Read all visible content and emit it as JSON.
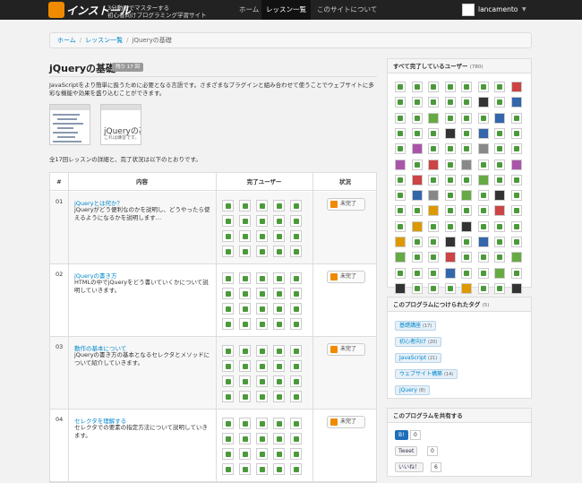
{
  "nav": {
    "logo_text": "インストール",
    "tagline1": "3分動画でマスターする",
    "tagline2": "初心者向けプログラミング学習サイト",
    "links": [
      "ホーム",
      "レッスン一覧",
      "このサイトについて"
    ],
    "user": "lancamento"
  },
  "breadcrumb": {
    "home": "ホーム",
    "lessons": "レッスン一覧",
    "current": "jQueryの基礎"
  },
  "course": {
    "title": "jQueryの基礎",
    "badge": "残り 17 回",
    "description": "JavaScriptをより簡単に扱うために必要となる言語です。さまざまなプラグインと組み合わせて使うことでウェブサイトに多彩な機能や効果を盛り込むことができます。",
    "preview_text": "jQueryの基本",
    "preview_sub": "これは練習です。",
    "summary": "全17回レッスンの詳細と、完了状況は以下のとおりです。"
  },
  "table": {
    "headers": [
      "#",
      "内容",
      "完了ユーザー",
      "状況"
    ],
    "rows": [
      {
        "num": "01",
        "title": "jQueryとは何か？",
        "desc": "jQueryがどう便利なのかを説明し、どうやったら使えるようになるかを説明します…",
        "status": "未完了"
      },
      {
        "num": "02",
        "title": "jQueryの書き方",
        "desc": "HTMLの中でjQueryをどう書いていくかについて説明していきます。",
        "status": "未完了"
      },
      {
        "num": "03",
        "title": "動作の基本について",
        "desc": "jQueryの書き方の基本となるセレクタとメソッドについて紹介していきます。",
        "status": "未完了"
      },
      {
        "num": "04",
        "title": "セレクタを理解する",
        "desc": "セレクタでの要素の指定方法について説明していきます。",
        "status": "未完了"
      }
    ]
  },
  "sidebar": {
    "users_title": "すべて完了しているユーザー",
    "users_count": "(780)",
    "tags_title": "このプログラムにつけられたタグ",
    "tags_count": "(5)",
    "tags": [
      {
        "name": "基礎講座",
        "count": "(17)"
      },
      {
        "name": "初心者向け",
        "count": "(20)"
      },
      {
        "name": "JavaScript",
        "count": "(21)"
      },
      {
        "name": "ウェブサイト構築",
        "count": "(14)"
      },
      {
        "name": "jQuery",
        "count": "(8)"
      }
    ],
    "share_title": "このプログラムを共有する",
    "hatena_label": "B!",
    "hatena_count": "0",
    "tweet_label": "Tweet",
    "tweet_count": "0",
    "like_label": "いいね！",
    "like_count": "6"
  },
  "colors": {
    "accent": "#f08a00",
    "link": "#0088cc",
    "avatar_green": "#4a9a3a"
  }
}
